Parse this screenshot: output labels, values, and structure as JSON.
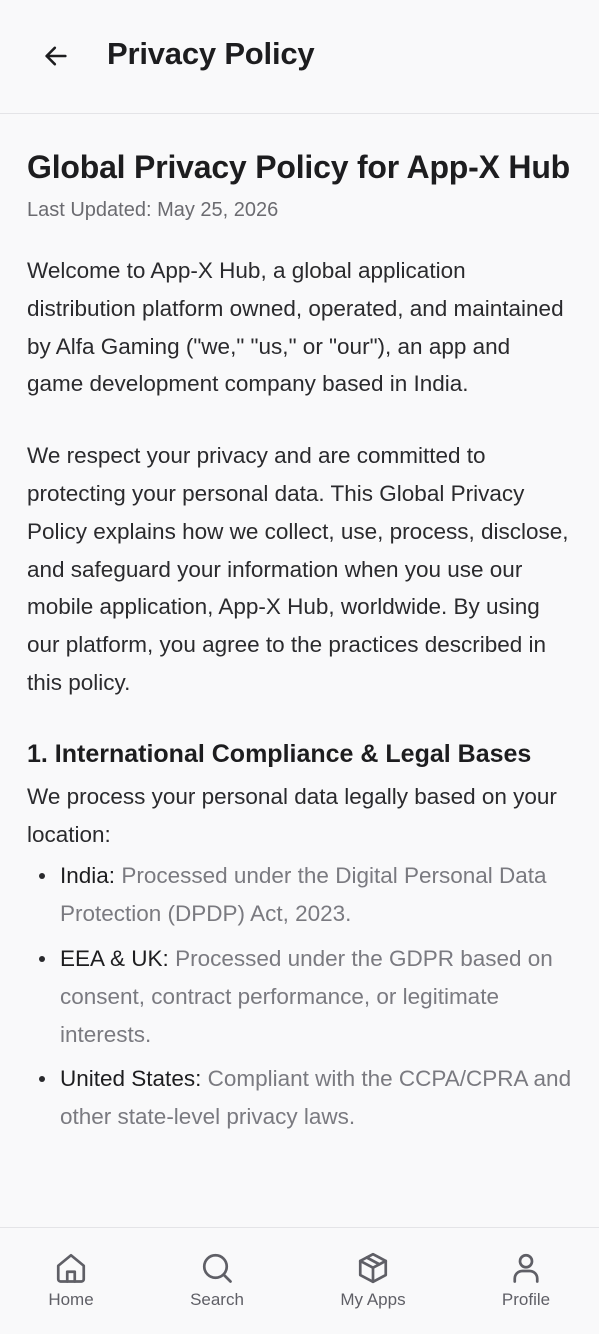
{
  "header": {
    "title": "Privacy Policy",
    "back_icon": "arrow-left-icon"
  },
  "document": {
    "title": "Global Privacy Policy for App-X Hub",
    "last_updated": "Last Updated: May 25, 2026",
    "paragraphs": [
      "Welcome to App-X Hub, a global application distribution platform owned, operated, and maintained by Alfa Gaming (\"we,\" \"us,\" or \"our\"), an app and game development company based in India.",
      "We respect your privacy and are committed to protecting your personal data. This Global Privacy Policy explains how we collect, use, process, disclose, and safeguard your information when you use our mobile application, App-X Hub, worldwide. By using our platform, you agree to the practices described in this policy."
    ],
    "sections": [
      {
        "heading": "1. International Compliance & Legal Bases",
        "intro": "We process your personal data legally based on your location:",
        "bullets": [
          {
            "term": "India:",
            "desc": "Processed under the Digital Personal Data Protection (DPDP) Act, 2023."
          },
          {
            "term": "EEA & UK:",
            "desc": "Processed under the GDPR based on consent, contract performance, or legitimate interests."
          },
          {
            "term": "United States:",
            "desc": "Compliant with the CCPA/CPRA and other state-level privacy laws."
          }
        ]
      }
    ]
  },
  "bottom_nav": {
    "items": [
      {
        "label": "Home",
        "icon": "home-icon"
      },
      {
        "label": "Search",
        "icon": "search-icon"
      },
      {
        "label": "My Apps",
        "icon": "box-icon"
      },
      {
        "label": "Profile",
        "icon": "user-icon"
      }
    ]
  },
  "colors": {
    "background": "#f9f9fa",
    "text_primary": "#1d1d1f",
    "text_secondary": "#7a7a80",
    "divider": "#e4e4e7"
  }
}
